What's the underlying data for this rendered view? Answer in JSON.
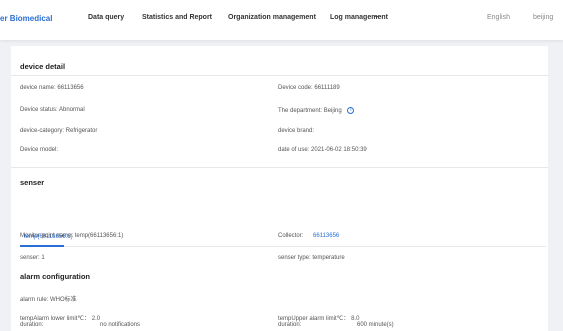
{
  "header": {
    "brand": "er Biomedical",
    "nav": [
      {
        "label": "Data query"
      },
      {
        "label": "Statistics and Report"
      },
      {
        "label": "Organization management"
      },
      {
        "label": "Log management"
      }
    ],
    "more": "···",
    "language": "English",
    "city": "beijing"
  },
  "device_detail": {
    "title": "device detail",
    "name_label": "device name:",
    "name_value": "66113656",
    "code_label": "Device code:",
    "code_value": "66111189",
    "status_label": "Device status:",
    "status_value": "Abnormal",
    "department_label": "The department:",
    "department_value": "Beijing",
    "info_icon": "i",
    "category_label": "device-category:",
    "category_value": "Refrigerator",
    "brand_label": "device brand:",
    "brand_value": "",
    "model_label": "Device model:",
    "model_value": "",
    "date_label": "date of use:",
    "date_value": "2021-06-02 18:50:39"
  },
  "senser": {
    "title": "senser",
    "tab": "temp(66113656:1)",
    "monitor_label": "Monitor point name:",
    "monitor_value": "temp(66113656:1)",
    "collector_label": "Collector:",
    "collector_value": "66113656",
    "senser_label": "senser:",
    "senser_value": "1",
    "type_label": "senser type:",
    "type_value": "temperature"
  },
  "alarm": {
    "title": "alarm configuration",
    "rule_label": "alarm rule:",
    "rule_value": "WHO标准",
    "lower_label": "tempAlarm lower limit℃：",
    "lower_value": "2.0",
    "upper_label": "tempUpper alarm limit℃：",
    "upper_value": "8.0",
    "duration_label_left": "duration:",
    "duration_value_left": "no notifications",
    "duration_label_right": "duration:",
    "duration_value_right": "600 minute(s)"
  },
  "colors": {
    "accent": "#2a6fd6",
    "background": "#f0f1f4"
  }
}
